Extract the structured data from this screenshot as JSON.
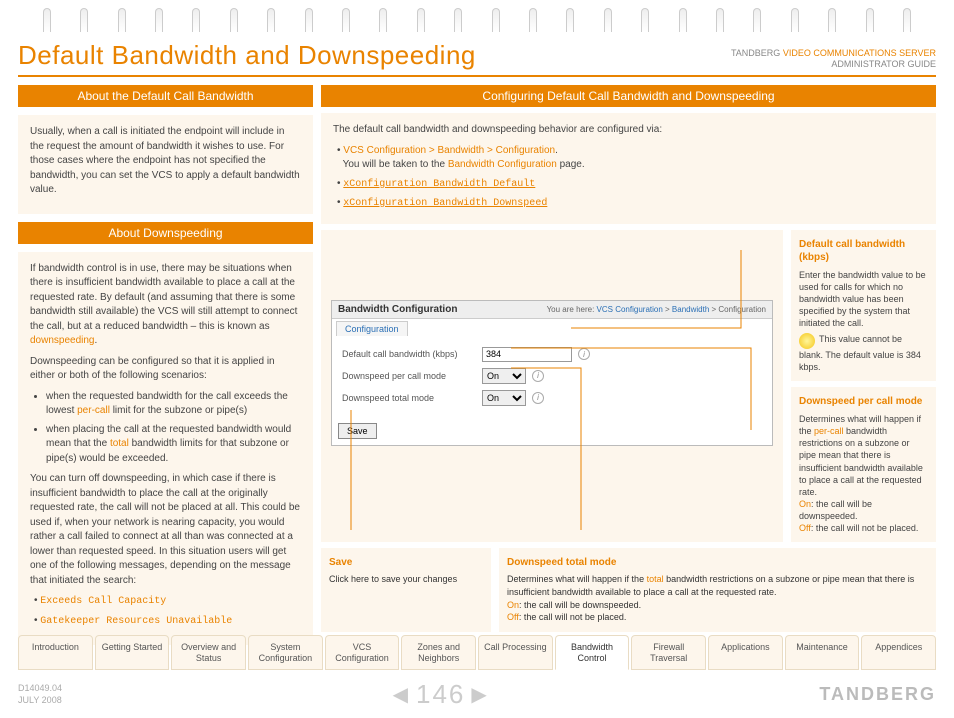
{
  "header": {
    "title": "Default Bandwidth and Downspeeding",
    "corp1": "TANDBERG",
    "corp2": "VIDEO COMMUNICATIONS SERVER",
    "corp3": "ADMINISTRATOR GUIDE"
  },
  "left": {
    "bar1": "About the Default Call Bandwidth",
    "p1": "Usually, when a call is initiated the endpoint will include in the request the amount of bandwidth it wishes to use.  For those cases where the endpoint has not specified the bandwidth, you can set the VCS to apply a default bandwidth value.",
    "bar2": "About Downspeeding",
    "p2a": "If bandwidth control is in use, there may be situations when there is insufficient bandwidth available to place a call at the requested rate.  By default (and assuming that there is some bandwidth still available) the VCS will still attempt to connect the call, but at a reduced bandwidth – this is known as ",
    "p2a_k": "downspeeding",
    "p2b": "Downspeeding can be configured so that it is applied in either or both of the following scenarios:",
    "li1a": "when the requested bandwidth for the call exceeds the lowest ",
    "li1k": "per-call",
    "li1b": " limit for the subzone or pipe(s)",
    "li2a": "when placing the call at the requested bandwidth would mean that the ",
    "li2k": "total",
    "li2b": " bandwidth limits for that subzone or pipe(s) would be exceeded.",
    "p3": "You can turn off downspeeding, in which case if there is insufficient bandwidth to place the call at the originally requested rate, the call will not be placed at all.  This could be used if, when your network is nearing capacity, you would rather a call failed to connect at all than was connected at a lower than requested speed. In this situation users will get one of the following messages, depending on the message that initiated the search:",
    "msg1": "Exceeds Call Capacity",
    "msg2": "Gatekeeper Resources Unavailable"
  },
  "right": {
    "bar": "Configuring Default Call Bandwidth and Downspeeding",
    "intro": "The default call bandwidth and downspeeding behavior are configured via:",
    "nav1": "VCS Configuration > Bandwidth > Configuration",
    "nav1b": "You will be taken to the ",
    "nav1c": "Bandwidth Configuration",
    "nav1d": " page.",
    "cmd1": "xConfiguration Bandwidth Default",
    "cmd2": "xConfiguration Bandwidth Downspeed",
    "panel": {
      "title": "Bandwidth Configuration",
      "crumb_pre": "You are here: ",
      "crumb1": "VCS Configuration",
      "crumb2": "Bandwidth",
      "crumb3": "Configuration",
      "tab": "Configuration",
      "f1": "Default call bandwidth (kbps)",
      "f1v": "384",
      "f2": "Downspeed per call mode",
      "f2v": "On",
      "f3": "Downspeed total mode",
      "f3v": "On",
      "save": "Save"
    },
    "info1": {
      "h": "Default call bandwidth (kbps)",
      "t": "Enter the bandwidth value to be used for calls for which no bandwidth value has been specified by the system that initiated the call.",
      "tip": "This value cannot be blank.  The default value is 384 kbps."
    },
    "info2": {
      "h": "Downspeed per call mode",
      "t1": "Determines what will happen if the ",
      "k": "per-call",
      "t2": " bandwidth restrictions on a subzone or pipe mean that there is insufficient bandwidth available to place a call at the requested rate.",
      "on": "On",
      "onD": ": the call will be downspeeded.",
      "off": "Off",
      "offD": ": the call will not be placed."
    },
    "below1": {
      "h": "Save",
      "t": "Click here to save your changes"
    },
    "below2": {
      "h": "Downspeed total mode",
      "t1": "Determines what will happen if the ",
      "k": "total",
      "t2": " bandwidth restrictions on a subzone or pipe mean that there is insufficient bandwidth available to place a call at the requested rate.",
      "on": "On",
      "onD": ": the call will be downspeeded.",
      "off": "Off",
      "offD": ": the call will not be placed."
    }
  },
  "tabs": [
    "Introduction",
    "Getting Started",
    "Overview and Status",
    "System Configuration",
    "VCS Configuration",
    "Zones and Neighbors",
    "Call Processing",
    "Bandwidth Control",
    "Firewall Traversal",
    "Applications",
    "Maintenance",
    "Appendices"
  ],
  "active_tab": 7,
  "footer": {
    "doc": "D14049.04",
    "date": "JULY 2008",
    "page": "146",
    "brand": "TANDBERG"
  }
}
